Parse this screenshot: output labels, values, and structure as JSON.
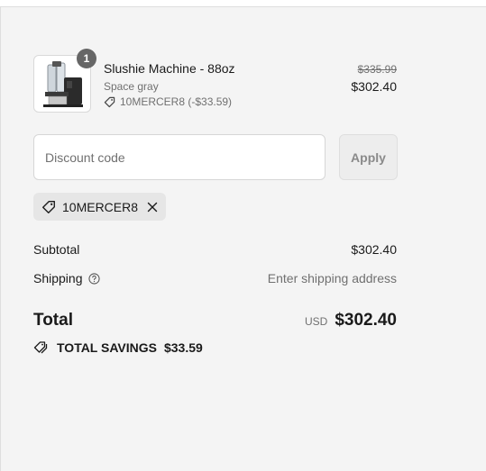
{
  "product": {
    "title": "Slushie Machine - 88oz",
    "variant": "Space gray",
    "discount_line": "10MERCER8 (-$33.59)",
    "quantity": "1",
    "price_original": "$335.99",
    "price_final": "$302.40",
    "image_icon": "slushie-machine-image"
  },
  "discount": {
    "placeholder": "Discount code",
    "value": "",
    "apply_label": "Apply",
    "applied_code": "10MERCER8"
  },
  "summary": {
    "subtotal_label": "Subtotal",
    "subtotal_value": "$302.40",
    "shipping_label": "Shipping",
    "shipping_value": "Enter shipping address",
    "total_label": "Total",
    "currency": "USD",
    "total_value": "$302.40",
    "savings_label": "TOTAL SAVINGS",
    "savings_value": "$33.59"
  },
  "icons": {
    "tag": "tag-icon",
    "close": "close-icon",
    "help": "help-circle-icon",
    "savings": "savings-tag-icon"
  },
  "colors": {
    "panel_bg": "#f4f4f4",
    "badge_bg": "#666666",
    "muted_text": "#707070"
  }
}
